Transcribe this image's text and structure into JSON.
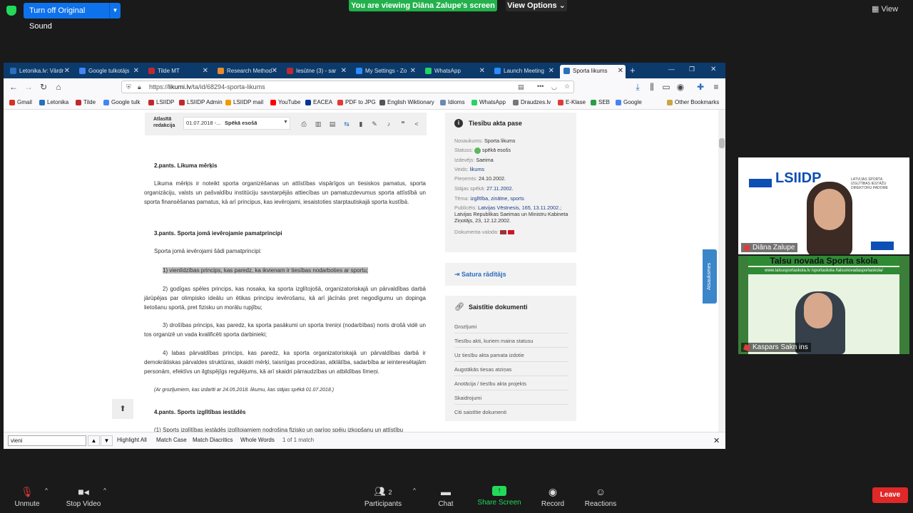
{
  "zoom": {
    "turn_off_sound": "Turn off Original Sound",
    "viewing_banner": "You are viewing Diāna Zalupe's screen",
    "view_options": "View Options",
    "view_label": "View",
    "participants_count": "2",
    "toolbar": {
      "unmute": "Unmute",
      "stop_video": "Stop Video",
      "participants": "Participants",
      "chat": "Chat",
      "share_screen": "Share Screen",
      "record": "Record",
      "reactions": "Reactions",
      "leave": "Leave"
    },
    "participants": [
      {
        "name": "Diāna Zalupe"
      },
      {
        "name": "Kaspars Sakn ins"
      }
    ],
    "tile1_logo": "LSIIDP",
    "tile1_subtitle": "LATVIJAS SPORTA IZGLĪTĪBAS IESTĀŽU DIREKTORU PADOME",
    "tile2_banner": "Talsu novada Sporta skola",
    "tile2_links": "www.talsusportaskola.lv  /sportaskola  /talsunovadasportaskola/"
  },
  "browser": {
    "tabs": [
      {
        "label": "Letonika.lv: Vārdr",
        "color": "#2a6ebd"
      },
      {
        "label": "Google tulkotājs",
        "color": "#4285f4"
      },
      {
        "label": "Tilde MT",
        "color": "#c0282e"
      },
      {
        "label": "Research Method",
        "color": "#e88a2e"
      },
      {
        "label": "Iesūtne (3) - sar",
        "color": "#c0282e"
      },
      {
        "label": "My Settings - Zo",
        "color": "#2d8cff"
      },
      {
        "label": "WhatsApp",
        "color": "#25d366"
      },
      {
        "label": "Launch Meeting",
        "color": "#2d8cff"
      },
      {
        "label": "Sporta likums",
        "color": "#2a6ebd"
      }
    ],
    "url_prefix": "https://",
    "url_domain": "likumi.lv",
    "url_path": "/ta/id/68294-sporta-likums",
    "bookmarks": [
      {
        "label": "Gmail",
        "color": "#d93025"
      },
      {
        "label": "Letonika",
        "color": "#2a6ebd"
      },
      {
        "label": "Tilde",
        "color": "#c0282e"
      },
      {
        "label": "Google tulk",
        "color": "#4285f4"
      },
      {
        "label": "LSIIDP",
        "color": "#c0282e"
      },
      {
        "label": "LSIIDP Admin",
        "color": "#c0282e"
      },
      {
        "label": "LSIIDP mail",
        "color": "#f29900"
      },
      {
        "label": "YouTube",
        "color": "#ff0000"
      },
      {
        "label": "EACEA",
        "color": "#003399"
      },
      {
        "label": "PDF to JPG",
        "color": "#e53935"
      },
      {
        "label": "English Wiktionary",
        "color": "#555555"
      },
      {
        "label": "Idioms",
        "color": "#6a8caf"
      },
      {
        "label": "WhatsApp",
        "color": "#25d366"
      },
      {
        "label": "Draudzes.lv",
        "color": "#777777"
      },
      {
        "label": "E-Klase",
        "color": "#e53935"
      },
      {
        "label": "SEB",
        "color": "#2a9d4a"
      },
      {
        "label": "Google",
        "color": "#4285f4"
      }
    ],
    "other_bookmarks": "Other Bookmarks",
    "find": {
      "value": "vieni",
      "highlight_all": "Highlight All",
      "match_case": "Match Case",
      "match_diacritics": "Match Diacritics",
      "whole_words": "Whole Words",
      "result": "1 of 1 match"
    }
  },
  "document": {
    "redakcija_line1": "Atlasītā",
    "redakcija_line2": "redakcija",
    "date_select": "01.07.2018 -...",
    "status_select": "Spēkā esošā",
    "art2_title": "2.pants. Likuma mērķis",
    "art2_text": "Likuma mērķis ir noteikt sporta organizēšanas un attīstības vispārīgos un tiesiskos pamatus, sporta organizāciju, valsts un pašvaldību institūciju savstarpējās attiecības un pamatuzdevumus sporta attīstībā un sporta finansēšanas pamatus, kā arī principus, kas ievērojami, iesaistoties starptautiskajā sporta kustībā.",
    "art3_title": "3.pants. Sporta jomā ievērojamie pamatprincipi",
    "art3_intro": "Sporta jomā ievērojami šādi pamatprincipi:",
    "art3_p1": "1) vienlīdzības princips, kas paredz, ka ikvienam ir tiesības nodarboties ar sportu;",
    "art3_p2": "2) godīgas spēles princips, kas nosaka, ka sporta izglītojošā, organizatoriskajā un pārvaldības darbā jārūpējas par olimpisko ideālu un ētikas principu ievērošanu, kā arī jācīnās pret negodīgumu un dopinga lietošanu sportā, pret fizisku un morālu rupjību;",
    "art3_p3": "3) drošības princips, kas paredz, ka sporta pasākumi un sporta treniņi (nodarbības) noris drošā vidē un tos organizē un vada kvalificēti sporta darbinieki;",
    "art3_p4": "4) labas pārvaldības princips, kas paredz, ka sporta organizatoriskajā un pārvaldības darbā ir demokrātiskas pārvaldes struktūras, skaidri mērķi, taisnīgas procedūras, atklātība, sadarbība ar ieinteresētajām personām, efektīvs un ilgtspējīgs regulējums, kā arī skaidri pārraudzības un atbildības līmeņi.",
    "art3_note": "(Ar grozījumiem, kas izdarīti ar 24.05.2018. likumu, kas stājas spēkā 01.07.2018.)",
    "art4_title": "4.pants. Sports izglītības iestādēs",
    "art4_text": "(1) Sports izglītības iestādēs izglītojamiem nodrošina fizisko un garīgo spēju izkopšanu un attīstību"
  },
  "sidebar": {
    "pase_title": "Tiesību akta pase",
    "meta": [
      {
        "label": "Nosaukums:",
        "value": "Sporta likums",
        "link": false
      },
      {
        "label": "Statuss:",
        "value": "spēkā esošs",
        "link": false
      },
      {
        "label": "Izdevējs:",
        "value": "Saeima",
        "link": false
      },
      {
        "label": "Veids:",
        "value": "likums",
        "link": true
      },
      {
        "label": "Pieņemts:",
        "value": "24.10.2002.",
        "link": false
      },
      {
        "label": "Stājas spēkā:",
        "value": "27.11.2002.",
        "link": true
      },
      {
        "label": "Tēma:",
        "value": "izglītība, zinātne, sports",
        "link": true
      }
    ],
    "publicets_label": "Publicēts:",
    "publicets_value1": "Latvijas Vēstnesis, 165, 13.11.2002.;",
    "publicets_value2": "Latvijas Republikas Saeimas un Ministru Kabineta",
    "publicets_value3": "Ziņotājs, 23, 12.12.2002.",
    "valoda_label": "Dokumenta valoda:",
    "saturs": "Satura rādītājs",
    "saistitie_title": "Saistītie dokumenti",
    "saistitie": [
      "Grozījumi",
      "Tiesību akti, kuriem maina statusu",
      "Uz tiesību akta pamata izdotie",
      "Augstākās tiesas atziņas",
      "Anotācija / tiesību akta projekts",
      "Skaidrojumi",
      "Citi saistītie dokumenti"
    ],
    "atsauksmes": "Atsauksmes"
  },
  "colors": {
    "zoom_blue": "#0e72ed",
    "zoom_green": "#23b14d",
    "leave_red": "#e02828",
    "tabbar": "#0c3a6b",
    "link_blue": "#1a3f8a"
  }
}
